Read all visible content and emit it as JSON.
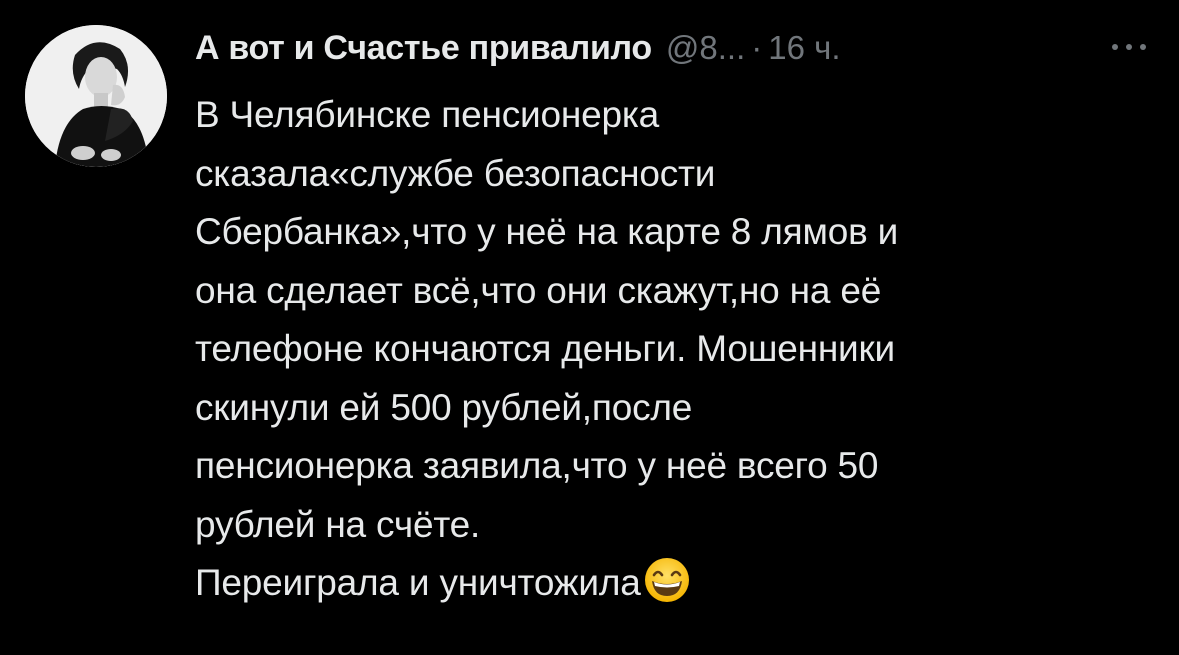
{
  "tweet": {
    "author": {
      "display_name": "А вот и Счастье привалило",
      "handle": "@8...",
      "avatar_icon": "profile-photo"
    },
    "separator": "·",
    "timestamp": "16 ч.",
    "more_icon": "more-dots-icon",
    "text_lines": [
      "В Челябинске пенсионерка",
      "сказала«службе безопасности",
      "Сбербанка»,что у неё на карте 8 лямов и",
      "она сделает всё,что они скажут,но на её",
      "телефоне кончаются деньги. Мошенники",
      "скинули ей 500 рублей,после",
      "пенсионерка заявила,что у неё всего 50",
      "рублей на счёте.",
      "Переиграла и уничтожила"
    ],
    "emoji": "grinning-face-with-smiling-eyes-emoji"
  },
  "colors": {
    "background": "#000000",
    "primary_text": "#e7e9ea",
    "secondary_text": "#71767b"
  }
}
